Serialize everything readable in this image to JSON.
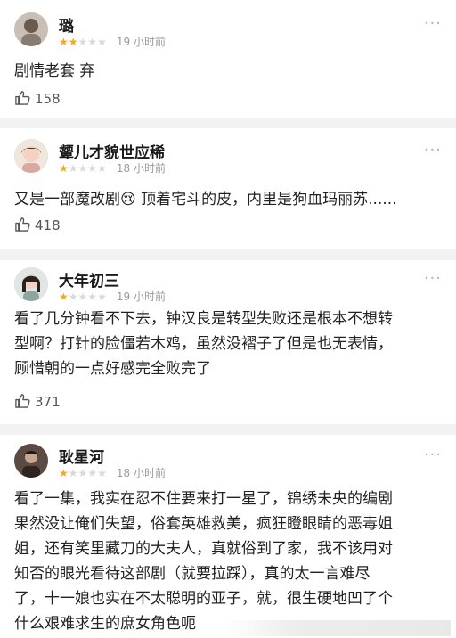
{
  "reviews": [
    {
      "user": "璐",
      "rating": 2,
      "time": "19 小时前",
      "text": "剧情老套 弃",
      "likes": "158"
    },
    {
      "user": "颦儿才貌世应稀",
      "rating": 1,
      "time": "18 小时前",
      "text": "又是一部魔改剧😢 顶着宅斗的皮，内里是狗血玛丽苏......",
      "likes": "418"
    },
    {
      "user": "大年初三",
      "rating": 1,
      "time": "19 小时前",
      "text": "看了几分钟看不下去，钟汉良是转型失败还是根本不想转\n型啊？打针的脸僵若木鸡，虽然没褶子了但是也无表情，\n顾惜朝的一点好感完全败完了",
      "likes": "371"
    },
    {
      "user": "耿星河",
      "rating": 1,
      "time": "18 小时前",
      "text": "看了一集，我实在忍不住要来打一星了，锦绣未央的编剧\n果然没让俺们失望，俗套英雄救美，疯狂瞪眼睛的恶毒姐\n姐，还有笑里藏刀的大夫人，真就俗到了家，我不该用对\n知否的眼光看待这部剧（就要拉踩），真的太一言难尽\n了，十一娘也实在不太聪明的亚子，就，很生硬地凹了个\n什么艰难求生的庶女角色呃",
      "likes": ""
    }
  ],
  "icons": {
    "star": "star-icon",
    "like": "thumbs-up-icon",
    "more": "more-options-icon"
  },
  "colors": {
    "star_on": "#f5a623",
    "star_off": "#d9d9d9",
    "divider": "#f2f2f2"
  }
}
